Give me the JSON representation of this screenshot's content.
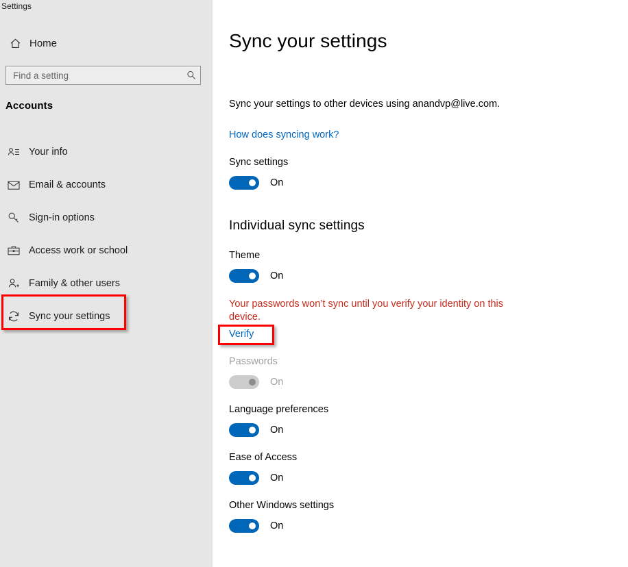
{
  "window": {
    "title": "Settings"
  },
  "sidebar": {
    "home_label": "Home",
    "home_icon": "home-icon",
    "search": {
      "placeholder": "Find a setting",
      "value": "",
      "icon": "search-icon"
    },
    "category": "Accounts",
    "items": [
      {
        "label": "Your info",
        "icon": "user-info-icon",
        "selected": false
      },
      {
        "label": "Email & accounts",
        "icon": "envelope-icon",
        "selected": false
      },
      {
        "label": "Sign-in options",
        "icon": "key-icon",
        "selected": false
      },
      {
        "label": "Access work or school",
        "icon": "briefcase-icon",
        "selected": false
      },
      {
        "label": "Family & other users",
        "icon": "user-add-icon",
        "selected": false
      },
      {
        "label": "Sync your settings",
        "icon": "sync-icon",
        "selected": true
      }
    ]
  },
  "main": {
    "page_title": "Sync your settings",
    "intro": "Sync your settings to other devices using anandvp@live.com.",
    "help_link": "How does syncing work?",
    "sync_settings": {
      "label": "Sync settings",
      "state": "On",
      "enabled": true
    },
    "individual_heading": "Individual sync settings",
    "warning_text": "Your passwords won’t sync until you verify your identity on this device.",
    "verify_link": "Verify",
    "toggles": [
      {
        "label": "Theme",
        "state": "On",
        "enabled": true
      },
      {
        "label": "Passwords",
        "state": "On",
        "enabled": false
      },
      {
        "label": "Language preferences",
        "state": "On",
        "enabled": true
      },
      {
        "label": "Ease of Access",
        "state": "On",
        "enabled": true
      },
      {
        "label": "Other Windows settings",
        "state": "On",
        "enabled": true
      }
    ]
  },
  "annotations": {
    "highlight_color": "#ff0000",
    "boxes": [
      {
        "target": "sidebar-item-sync-your-settings"
      },
      {
        "target": "verify-link"
      }
    ]
  },
  "colors": {
    "accent": "#0067b8",
    "link": "#0067c0",
    "error": "#c42b1c",
    "sidebar_bg": "#e6e6e6",
    "main_bg": "#ffffff",
    "disabled_track": "#cccccc",
    "disabled_text": "#a0a0a0"
  }
}
